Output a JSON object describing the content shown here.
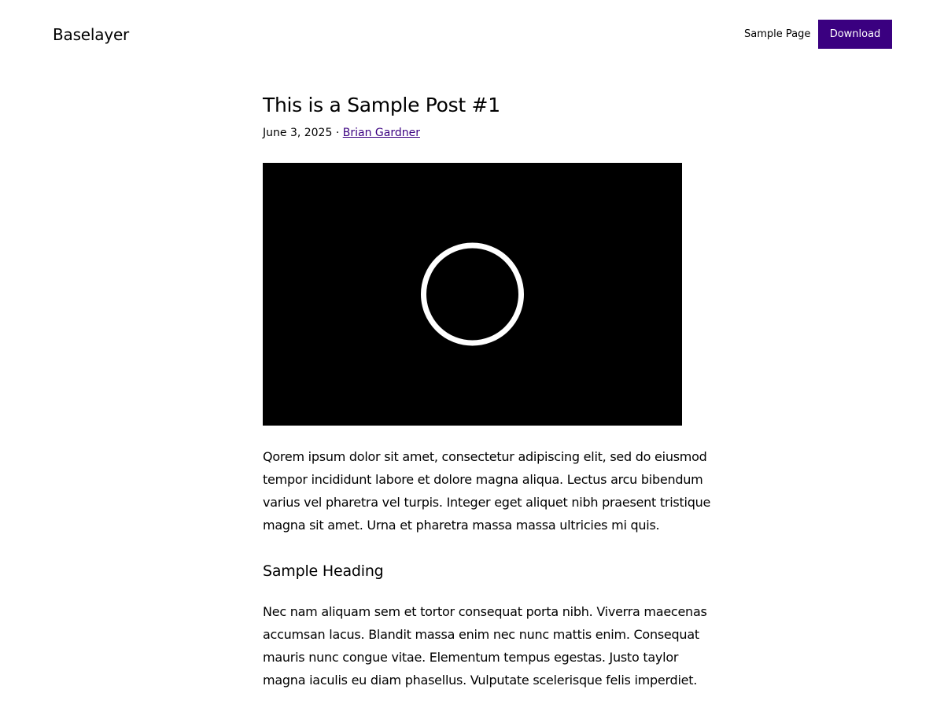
{
  "header": {
    "site_title": "Baselayer",
    "nav": {
      "sample_page": "Sample Page",
      "download": "Download"
    }
  },
  "post": {
    "title": "This is a Sample Post #1",
    "date": "June 3, 2025",
    "separator": "·",
    "author": "Brian Gardner",
    "paragraph_1": [
      "Qorem ipsum dolor sit amet, consectetur adipiscing elit, sed do eiusmod",
      "tempor incididunt labore et dolore magna aliqua. Lectus arcu bibendum",
      "varius vel pharetra vel turpis. Integer eget aliquet nibh praesent tristique",
      "magna sit amet. Urna et pharetra massa massa ultricies mi quis."
    ],
    "heading": "Sample Heading",
    "paragraph_2": [
      "Nec nam aliquam sem et tortor consequat porta nibh. Viverra maecenas",
      "accumsan lacus. Blandit massa enim nec nunc mattis enim. Consequat",
      "mauris nunc congue vitae. Elementum tempus egestas. Justo taylor",
      "magna iaculis eu diam phasellus. Vulputate scelerisque felis imperdiet."
    ]
  },
  "colors": {
    "accent": "#3a0080",
    "video_background": "#000000",
    "spinner": "#ffffff"
  },
  "icons": {
    "video": "loading-spinner-icon"
  }
}
